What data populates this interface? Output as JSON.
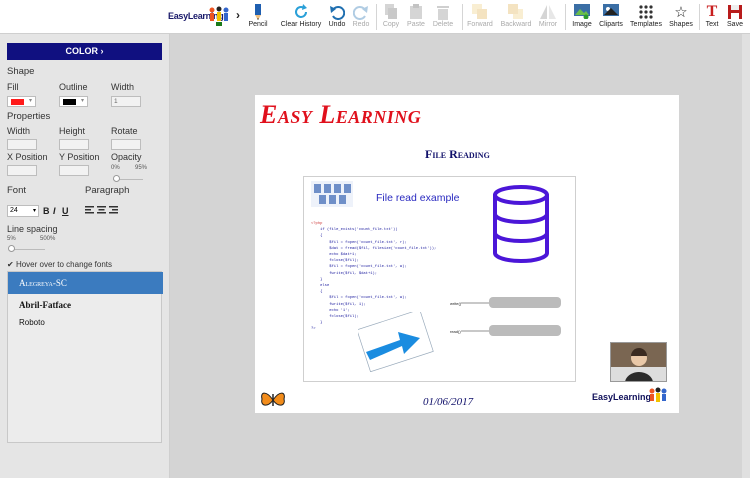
{
  "toolbar": {
    "logo_text": "EasyLearning",
    "tools": [
      {
        "name": "pencil",
        "label": "Pencil",
        "disabled": false
      },
      {
        "name": "clear-history",
        "label": "Clear History",
        "disabled": false
      },
      {
        "name": "undo",
        "label": "Undo",
        "disabled": false
      },
      {
        "name": "redo",
        "label": "Redo",
        "disabled": true
      },
      {
        "name": "copy",
        "label": "Copy",
        "disabled": true
      },
      {
        "name": "paste",
        "label": "Paste",
        "disabled": true
      },
      {
        "name": "delete",
        "label": "Delete",
        "disabled": true
      },
      {
        "name": "forward",
        "label": "Forward",
        "disabled": true
      },
      {
        "name": "backward",
        "label": "Backward",
        "disabled": true
      },
      {
        "name": "mirror",
        "label": "Mirror",
        "disabled": true
      },
      {
        "name": "image",
        "label": "Image",
        "disabled": false
      },
      {
        "name": "cliparts",
        "label": "Cliparts",
        "disabled": false
      },
      {
        "name": "templates",
        "label": "Templates",
        "disabled": false
      },
      {
        "name": "shapes",
        "label": "Shapes",
        "disabled": false
      },
      {
        "name": "text",
        "label": "Text",
        "disabled": false
      },
      {
        "name": "save",
        "label": "Save",
        "disabled": false
      }
    ]
  },
  "panel": {
    "color_button": "COLOR",
    "shape_heading": "Shape",
    "fill_label": "Fill",
    "outline_label": "Outline",
    "width_label": "Width",
    "width_value": "1",
    "fill_color": "#ff1a1a",
    "outline_color": "#000000",
    "properties_heading": "Properties",
    "p_width": "Width",
    "p_height": "Height",
    "p_rotate": "Rotate",
    "p_xpos": "X Position",
    "p_ypos": "Y Position",
    "p_opacity": "Opacity",
    "opacity_min": "0%",
    "opacity_max": "95%",
    "font_heading": "Font",
    "paragraph_heading": "Paragraph",
    "font_size": "24",
    "bold": "B",
    "italic": "I",
    "underline": "U",
    "line_spacing_label": "Line spacing",
    "ls_min": "5%",
    "ls_max": "500%",
    "hover_label": "Hover over to change fonts",
    "fonts": [
      "Alegreya-SC",
      "Abril-Fatface",
      "Roboto"
    ]
  },
  "slide": {
    "title": "Easy Learning",
    "subtitle": "File Reading",
    "card_title": "File read example",
    "date": "01/06/2017",
    "logo_text": "EasyLearning"
  }
}
